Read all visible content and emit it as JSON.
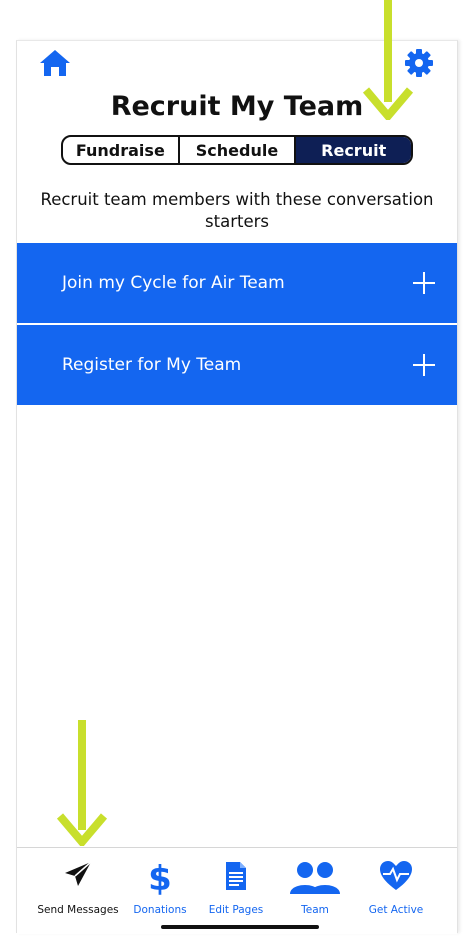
{
  "header": {
    "title": "Recruit My Team",
    "home_icon": "home-icon",
    "settings_icon": "gear-icon"
  },
  "segments": {
    "items": [
      "Fundraise",
      "Schedule",
      "Recruit"
    ],
    "selected": "Recruit"
  },
  "description": "Recruit team members with these conversation starters",
  "accordion": [
    {
      "label": "Join my Cycle for Air Team",
      "icon": "plus-icon"
    },
    {
      "label": "Register for My Team",
      "icon": "plus-icon"
    }
  ],
  "tabbar": [
    {
      "label": "Send Messages",
      "icon": "paper-plane-icon"
    },
    {
      "label": "Donations",
      "icon": "dollar-icon"
    },
    {
      "label": "Edit Pages",
      "icon": "document-icon"
    },
    {
      "label": "Team",
      "icon": "team-icon"
    },
    {
      "label": "Get Active",
      "icon": "heart-pulse-icon"
    }
  ],
  "colors": {
    "accent": "#1466f0",
    "selected_segment": "#0e1f55",
    "annotation_arrow": "#c8df2c"
  }
}
